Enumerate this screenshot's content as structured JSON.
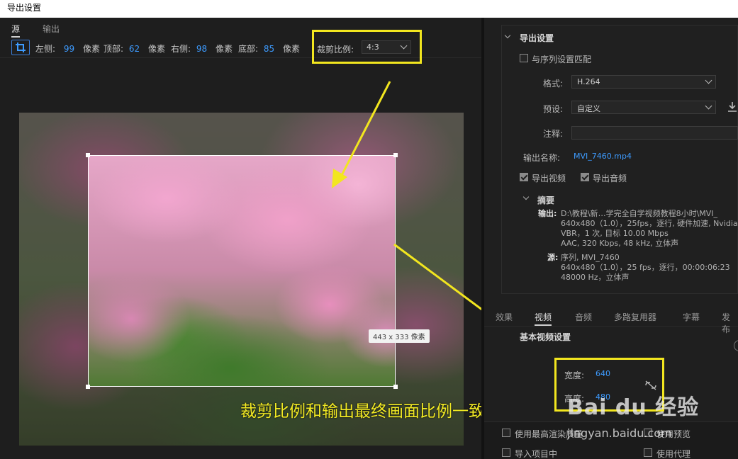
{
  "window": {
    "title": "导出设置"
  },
  "source_panel": {
    "tabs": [
      "源",
      "输出"
    ],
    "crop": {
      "left_label": "左侧:",
      "left_value": "99",
      "left_unit": "像素",
      "top_label": "顶部:",
      "top_value": "62",
      "top_unit": "像素",
      "right_label": "右侧:",
      "right_value": "98",
      "right_unit": "像素",
      "bottom_label": "底部:",
      "bottom_value": "85",
      "bottom_unit": "像素",
      "ratio_label": "裁剪比例:",
      "ratio_value": "4:3"
    },
    "preview": {
      "size_badge": "443 x 333 像素"
    },
    "annotation_caption": "裁剪比例和输出最终画面比例一致"
  },
  "export_settings": {
    "section_title": "导出设置",
    "match_sequence_label": "与序列设置匹配",
    "format_label": "格式:",
    "format_value": "H.264",
    "preset_label": "预设:",
    "preset_value": "自定义",
    "comment_label": "注释:",
    "comment_value": "",
    "output_name_label": "输出名称:",
    "output_name_value": "MVI_7460.mp4",
    "export_video_label": "导出视频",
    "export_audio_label": "导出音频",
    "summary": {
      "title": "摘要",
      "output_label": "输出:",
      "output_lines": [
        "D:\\教程\\新…学完全自学视频教程8小时\\MVI_",
        "640x480（1.0），25fps，逐行, 硬件加速, Nvidia",
        "VBR，1 次, 目标 10.00 Mbps",
        "AAC, 320 Kbps, 48  kHz, 立体声"
      ],
      "source_label": "源:",
      "source_lines": [
        "序列, MVI_7460",
        "640x480（1.0），25 fps，逐行，00:00:06:23",
        "48000 Hz，立体声"
      ]
    }
  },
  "settings_tabs": [
    "效果",
    "视频",
    "音频",
    "多路复用器",
    "字幕",
    "发布"
  ],
  "video_settings": {
    "section_title": "基本视频设置",
    "width_label": "宽度:",
    "width_value": "640",
    "height_label": "高度:",
    "height_value": "480"
  },
  "bottom_options": {
    "max_render_label": "使用最高渲染质量",
    "use_preview_label": "使用预览",
    "import_label": "导入项目中",
    "use_proxy_label": "使用代理"
  },
  "watermark": {
    "logo": "Bai du 经验",
    "site": "jingyan.baidu.com"
  },
  "colors": {
    "accent": "#3d9bff",
    "highlight": "#f2e61f",
    "background": "#1e1e1e"
  }
}
